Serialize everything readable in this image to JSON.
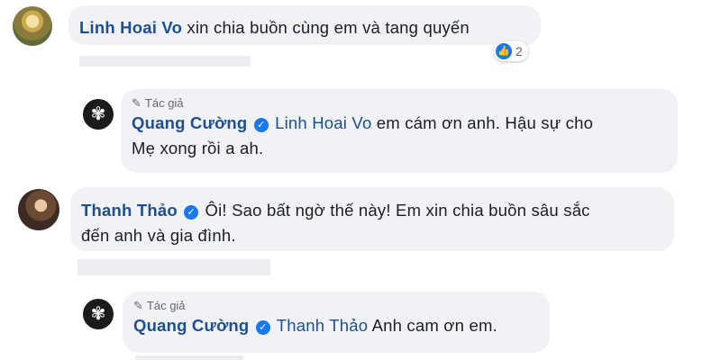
{
  "comments": [
    {
      "author": "Linh Hoai Vo",
      "text": "xin chia buồn cùng em và tang quyến",
      "reactions": {
        "icon": "like-icon",
        "count": "2"
      }
    },
    {
      "badge": "Tác giả",
      "author": "Quang Cường",
      "mention": "Linh Hoai Vo",
      "text_line1": "em cám ơn anh. Hậu sự cho",
      "text_line2": "Mẹ xong rồi a ah."
    },
    {
      "author": "Thanh Thảo",
      "text_line1": "Ôi! Sao bất ngờ thế này! Em xin chia buồn sâu sắc",
      "text_line2": "đến anh và gia đình."
    },
    {
      "badge": "Tác giả",
      "author": "Quang Cường",
      "mention": "Thanh Thảo",
      "text": "Anh cam ơn em."
    }
  ],
  "colors": {
    "bubble": "#f0f2f5",
    "name": "#1d4f91",
    "verified": "#1877f2"
  }
}
